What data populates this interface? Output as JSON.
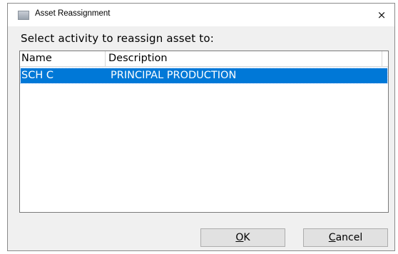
{
  "window": {
    "title": "Asset Reassignment",
    "close_glyph": "×"
  },
  "prompt": "Select activity to reassign asset to:",
  "list": {
    "columns": [
      "Name",
      "Description"
    ],
    "rows": [
      {
        "name": "SCH C",
        "description": "PRINCIPAL PRODUCTION",
        "selected": true
      }
    ]
  },
  "buttons": {
    "ok": {
      "mnemonic": "O",
      "rest": "K"
    },
    "cancel": {
      "mnemonic": "C",
      "rest": "ancel"
    }
  },
  "colors": {
    "selection": "#0078d7",
    "dialog_bg": "#f0f0f0",
    "button_bg": "#e1e1e1"
  },
  "icons": {
    "title": "app-icon",
    "close": "close-icon"
  }
}
